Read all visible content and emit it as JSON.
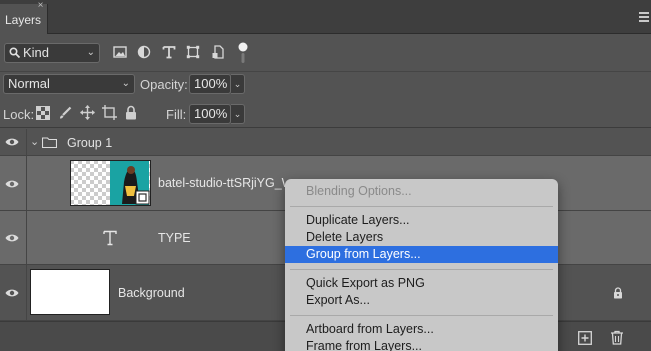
{
  "panel": {
    "tab_label": "Layers",
    "close_glyph": "×"
  },
  "filter": {
    "kind_label": "Kind",
    "icons": [
      "image-filter-icon",
      "adjustment-filter-icon",
      "type-filter-icon",
      "shape-filter-icon",
      "smart-object-filter-icon",
      "filter-toggle-icon"
    ]
  },
  "blend": {
    "mode": "Normal",
    "opacity_label": "Opacity:",
    "opacity_value": "100%"
  },
  "lock": {
    "label": "Lock:",
    "fill_label": "Fill:",
    "fill_value": "100%"
  },
  "layers": [
    {
      "name": "Group 1",
      "type": "group"
    },
    {
      "name": "batel-studio-ttSRjiYG_Wk-unsplash",
      "type": "image"
    },
    {
      "name": "TYPE",
      "type": "text"
    },
    {
      "name": "Background",
      "type": "background"
    }
  ],
  "context_menu": {
    "items": [
      {
        "label": "Blending Options...",
        "state": "disabled"
      },
      {
        "label": "Duplicate Layers...",
        "state": "normal"
      },
      {
        "label": "Delete Layers",
        "state": "normal"
      },
      {
        "label": "Group from Layers...",
        "state": "highlighted"
      },
      {
        "label": "Quick Export as PNG",
        "state": "normal"
      },
      {
        "label": "Export As...",
        "state": "normal"
      },
      {
        "label": "Artboard from Layers...",
        "state": "normal"
      },
      {
        "label": "Frame from Layers...",
        "state": "normal"
      }
    ]
  },
  "colors": {
    "panel_bg": "#535353",
    "menu_bg": "#c8c8c8",
    "highlight": "#2d6fe0",
    "thumb_teal": "#1aa3a3"
  }
}
